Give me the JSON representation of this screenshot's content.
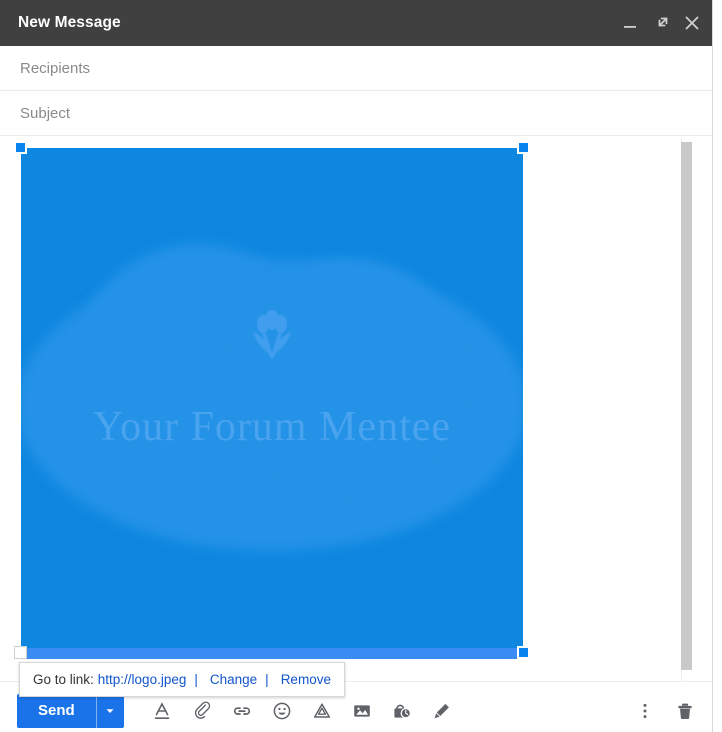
{
  "window": {
    "title": "New Message",
    "controls": [
      {
        "name": "minimize",
        "label": "Minimize"
      },
      {
        "name": "fullscreen",
        "label": "Full screen"
      },
      {
        "name": "close",
        "label": "Close"
      }
    ]
  },
  "fields": {
    "recipients": {
      "label": "Recipients",
      "value": "",
      "placeholder": "Recipients"
    },
    "subject": {
      "label": "Subject",
      "value": "",
      "placeholder": "Subject"
    }
  },
  "body": {
    "inline_image": {
      "caption": "Your Forum Mentee",
      "link": "http://logo.jpeg",
      "selected": true,
      "bg_color": "#0e87e0",
      "cloud_color": "#2492e6",
      "caption_color": "#4aa3ef",
      "selection_handle_color": "#0c84ef"
    }
  },
  "link_bubble": {
    "prefix": "Go to link:",
    "url": "http://logo.jpeg",
    "separator": "|",
    "change_label": "Change",
    "remove_label": "Remove",
    "link_color": "#1155cc"
  },
  "toolbar": {
    "send_label": "Send",
    "send_color": "#1a73e8",
    "send_dropdown_icon": "chevron-down-icon",
    "icons": [
      {
        "name": "formatting-options-icon",
        "label": "Formatting options"
      },
      {
        "name": "attach-file-icon",
        "label": "Attach files"
      },
      {
        "name": "insert-link-icon",
        "label": "Insert link"
      },
      {
        "name": "insert-emoji-icon",
        "label": "Insert emoji"
      },
      {
        "name": "insert-drive-icon",
        "label": "Insert files using Drive"
      },
      {
        "name": "insert-photo-icon",
        "label": "Insert photo"
      },
      {
        "name": "confidential-mode-icon",
        "label": "Toggle confidential mode"
      },
      {
        "name": "insert-signature-icon",
        "label": "Insert signature"
      }
    ],
    "right_icons": [
      {
        "name": "more-options-icon",
        "label": "More options"
      },
      {
        "name": "discard-draft-icon",
        "label": "Discard draft"
      }
    ]
  },
  "scrollbar": {
    "name": "body-scrollbar",
    "orientation": "vertical"
  }
}
